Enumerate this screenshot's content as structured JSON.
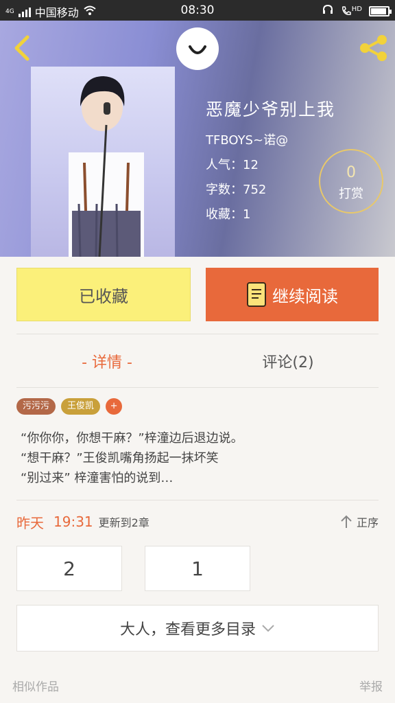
{
  "status_bar": {
    "network": "4G",
    "carrier": "中国移动",
    "time": "08:30",
    "hd_label": "HD",
    "icons": [
      "signal-icon",
      "wifi-icon",
      "headset-icon",
      "phone-hd-icon",
      "battery-icon"
    ]
  },
  "header": {
    "back_icon": "chevron-left-icon",
    "share_icon": "share-icon",
    "avatar_icon": "smile-icon"
  },
  "book": {
    "title": "恶魔少爷别上我",
    "author": "TFBOYS~诺@",
    "popularity": "人气：12",
    "word_count": "字数：752",
    "favorites": "收藏：1",
    "tip_count": "0",
    "tip_label": "打赏"
  },
  "actions": {
    "favorited_label": "已收藏",
    "continue_label": "继续阅读",
    "book_icon": "book-icon"
  },
  "tabs": [
    {
      "label": "- 详情 -",
      "active": true
    },
    {
      "label": "评论(2)",
      "active": false
    }
  ],
  "tags": [
    "污污污",
    "王俊凯",
    "+"
  ],
  "description": [
    "“你你你，你想干麻？”梓潼边后退边说。",
    "“想干麻？”王俊凯嘴角扬起一抹坏笑",
    "“别过来” 梓潼害怕的说到…"
  ],
  "update": {
    "day": "昨天",
    "time": "19:31",
    "message": "更新到2章",
    "sort_label": "正序",
    "sort_icon": "arrow-up-icon"
  },
  "chapters": [
    "2",
    "1"
  ],
  "more_catalog": {
    "label": "大人，查看更多目录",
    "icon": "chevron-down-icon"
  },
  "footer": {
    "similar": "相似作品",
    "report": "举报"
  },
  "colors": {
    "accent": "#e8693b",
    "favorite_bg": "#fbf07a",
    "tip_ring": "#e8c86a"
  }
}
